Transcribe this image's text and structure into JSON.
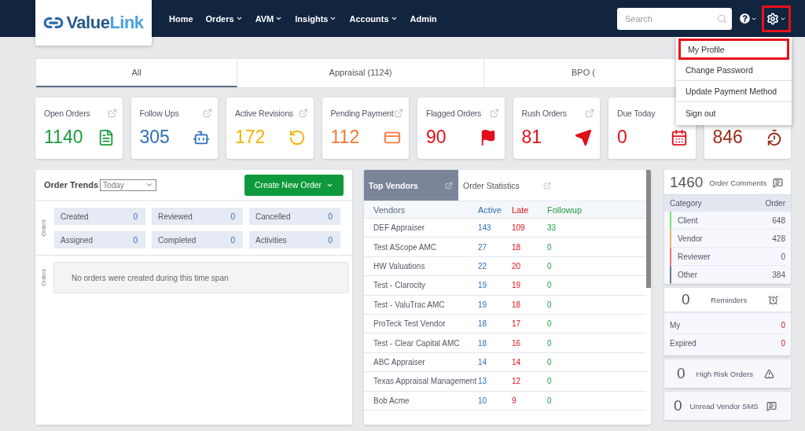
{
  "logo": {
    "text_dark": "Value",
    "text_light": "Link"
  },
  "nav": [
    {
      "label": "Home",
      "dropdown": false
    },
    {
      "label": "Orders",
      "dropdown": true
    },
    {
      "label": "AVM",
      "dropdown": true
    },
    {
      "label": "Insights",
      "dropdown": true
    },
    {
      "label": "Accounts",
      "dropdown": true
    },
    {
      "label": "Admin",
      "dropdown": false
    }
  ],
  "search": {
    "placeholder": "Search"
  },
  "settings": {
    "highlighted": true,
    "expanded": true
  },
  "settings_menu": [
    {
      "label": "My Profile",
      "highlighted": true
    },
    {
      "label": "Change Password",
      "highlighted": false
    },
    {
      "label": "Update Payment Method",
      "highlighted": false
    },
    {
      "label": "Sign out",
      "highlighted": false
    }
  ],
  "tabs": [
    {
      "label": "All",
      "selected": true
    },
    {
      "label": "Appraisal (1124)",
      "selected": false
    },
    {
      "label": "BPO (",
      "selected": false
    }
  ],
  "stat_cards": [
    {
      "title": "Open Orders",
      "value": "1140",
      "color": "#1a9c3e",
      "kind": "document",
      "link": true
    },
    {
      "title": "Follow Ups",
      "value": "305",
      "color": "#2f6fb8",
      "kind": "bot",
      "link": true
    },
    {
      "title": "Active Revisions",
      "value": "172",
      "color": "#f0b400",
      "kind": "revision",
      "link": true
    },
    {
      "title": "Pending Payment",
      "value": "112",
      "color": "#f5793a",
      "kind": "payment",
      "link": true
    },
    {
      "title": "Flagged Orders",
      "value": "90",
      "color": "#e0101b",
      "kind": "flag",
      "link": true
    },
    {
      "title": "Rush Orders",
      "value": "81",
      "color": "#e0101b",
      "kind": "plane",
      "link": true
    },
    {
      "title": "Due Today",
      "value": "0",
      "color": "#e0101b",
      "kind": "calendar",
      "link": false
    },
    {
      "value": "846",
      "color": "#9b2b16",
      "kind": "timer",
      "link": false
    }
  ],
  "order_trends": {
    "title": "Order Trends",
    "period": "Today",
    "create_button": "Create New Order",
    "axis_label_top": "Orders",
    "axis_label_bottom": "Orders",
    "tiles": [
      {
        "label": "Created",
        "value": "0"
      },
      {
        "label": "Reviewed",
        "value": "0"
      },
      {
        "label": "Cancelled",
        "value": "0"
      },
      {
        "label": "Assigned",
        "value": "0"
      },
      {
        "label": "Completed",
        "value": "0"
      },
      {
        "label": "Activities",
        "value": "0"
      }
    ],
    "empty_message": "No orders were created during this time span"
  },
  "vendor_panel": {
    "tabs": [
      {
        "label": "Top Vendors",
        "selected": true
      },
      {
        "label": "Order Statistics",
        "selected": false
      }
    ],
    "columns": [
      {
        "label": "Vendors",
        "color": "#5a6b82"
      },
      {
        "label": "Active",
        "color": "#2f6fb8"
      },
      {
        "label": "Late",
        "color": "#e0101b"
      },
      {
        "label": "Followup",
        "color": "#1a9c3e"
      }
    ],
    "rows": [
      [
        "DEF Appraiser",
        "143",
        "109",
        "33"
      ],
      [
        "Test AScope AMC",
        "27",
        "18",
        "0"
      ],
      [
        "HW Valuations",
        "22",
        "20",
        "0"
      ],
      [
        "Test - Clarocity",
        "19",
        "19",
        "0"
      ],
      [
        "Test - ValuTrac AMC",
        "19",
        "18",
        "0"
      ],
      [
        "ProTeck Test Vendor",
        "18",
        "17",
        "0"
      ],
      [
        "Test - Clear Capital AMC",
        "18",
        "16",
        "0"
      ],
      [
        "ABC Appraiser",
        "14",
        "14",
        "0"
      ],
      [
        "Texas Appraisal Management",
        "13",
        "12",
        "0"
      ],
      [
        "Bob Acme",
        "10",
        "9",
        "0"
      ]
    ]
  },
  "order_comments": {
    "count": "1460",
    "title": "Order Comments",
    "col_category": "Category",
    "col_order": "Order",
    "rows": [
      {
        "label": "Client",
        "value": "648",
        "color": "#7ddc7d"
      },
      {
        "label": "Vendor",
        "value": "428",
        "color": "#e8b86b"
      },
      {
        "label": "Reviewer",
        "value": "0",
        "color": "#e87474"
      },
      {
        "label": "Other",
        "value": "384",
        "color": "#6b7a90"
      }
    ]
  },
  "reminders": {
    "count": "0",
    "title": "Reminders",
    "rows": [
      {
        "label": "My",
        "value": "0"
      },
      {
        "label": "Expired",
        "value": "0"
      }
    ]
  },
  "small_cards": [
    {
      "count": "0",
      "title": "High Risk Orders",
      "kind": "warning"
    },
    {
      "count": "0",
      "title": "Unread Vendor SMS",
      "kind": "message"
    }
  ]
}
